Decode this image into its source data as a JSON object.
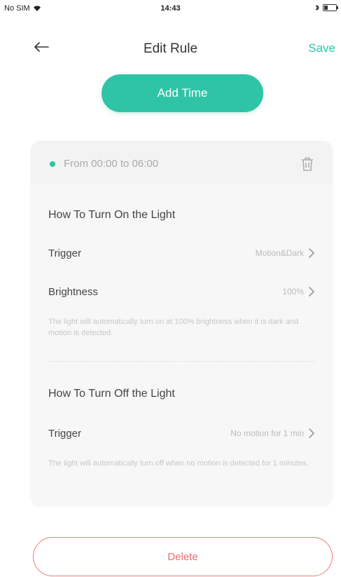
{
  "status_bar": {
    "carrier": "No SIM",
    "time": "14:43"
  },
  "nav": {
    "title": "Edit Rule",
    "save_label": "Save",
    "back_icon": "arrow-left-icon"
  },
  "add_time_label": "Add Time",
  "rule": {
    "time_range": "From 00:00 to 06:00",
    "status_color": "#2fc4a6",
    "on_section": {
      "title": "How To Turn On the Light",
      "trigger_label": "Trigger",
      "trigger_value": "Motion&Dark",
      "brightness_label": "Brightness",
      "brightness_value": "100%",
      "note": "The light will automatically turn on at 100% brightness when it is dark and motion is detected."
    },
    "off_section": {
      "title": "How To Turn Off the Light",
      "trigger_label": "Trigger",
      "trigger_value": "No motion for 1 min",
      "note": "The light will automatically turn off when no motion is detected for 1 minutes."
    }
  },
  "delete_label": "Delete",
  "colors": {
    "accent": "#2fc4a6",
    "danger": "#ef6c6c"
  }
}
